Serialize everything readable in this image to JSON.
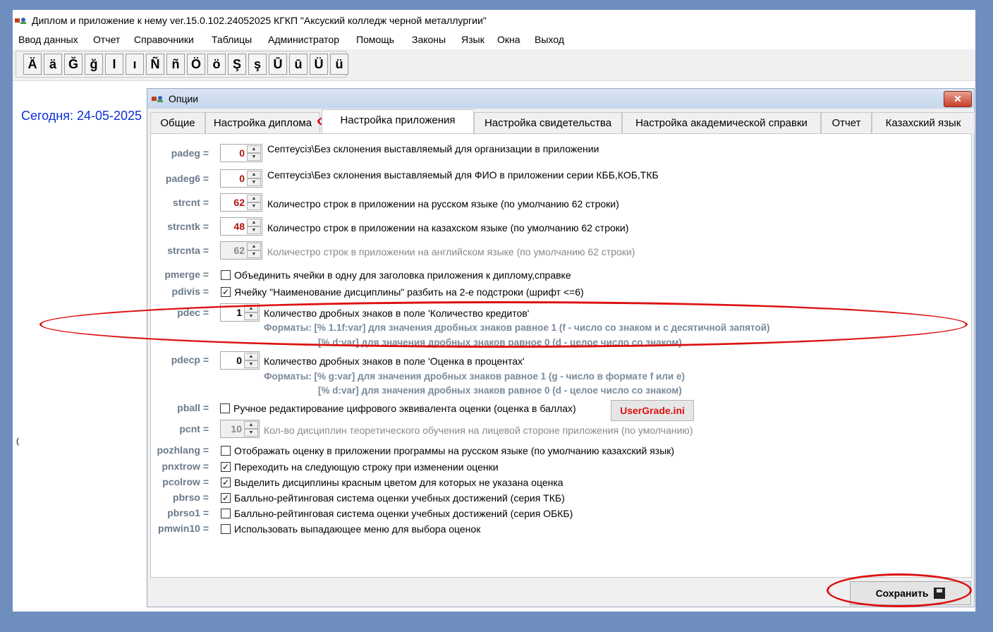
{
  "window": {
    "title": "Диплом и приложение к нему ver.15.0.102.24052025 КГКП \"Аксуский колледж черной металлургии\""
  },
  "menu": [
    "Ввод данных",
    "Отчет",
    "Справочники",
    "Таблицы",
    "Администратор",
    "Помощь",
    "Законы",
    "Язык",
    "Окна",
    "Выход"
  ],
  "keyboard": [
    "Ä",
    "ä",
    "Ğ",
    "ğ",
    "I",
    "ı",
    "Ñ",
    "ñ",
    "Ö",
    "ö",
    "Ş",
    "ş",
    "Ū",
    "ū",
    "Ü",
    "ü"
  ],
  "today_text": "Сегодня: 24-05-2025",
  "stray_char": "(",
  "under_text": "",
  "dialog": {
    "title": "Опции",
    "close_label": "✕",
    "tabs": [
      "Общие",
      "Настройка диплома",
      "Настройка приложения",
      "Настройка свидетельства",
      "Настройка академической справки",
      "Отчет",
      "Казахский язык"
    ],
    "active_tab": "Настройка приложения",
    "settings": {
      "padeg": {
        "label": "padeg =",
        "value": "0",
        "desc": "Септеусіз\\Без склонения выставляемый для организации в приложении"
      },
      "padeg6": {
        "label": "padeg6 =",
        "value": "0",
        "desc": "Септеусіз\\Без склонения выставляемый для ФИО в приложении серии КББ,КОБ,ТКБ"
      },
      "strcnt": {
        "label": "strcnt =",
        "value": "62",
        "desc": "Количестро строк в приложении на русском языке (по умолчанию 62 строки)"
      },
      "strcntk": {
        "label": "strcntk =",
        "value": "48",
        "desc": "Количестро строк в приложении на казахском языке (по умолчанию 62 строки)"
      },
      "strcnta": {
        "label": "strcnta =",
        "value": "62",
        "desc": "Количестро строк в приложении на английском языке (по умолчанию 62 строки)"
      },
      "pmerge": {
        "label": "pmerge =",
        "checked": false,
        "desc": "Объединить ячейки в одну для заголовка приложения к диплому,справке"
      },
      "pdivis": {
        "label": "pdivis =",
        "checked": true,
        "desc": "Ячейку \"Наименование дисциплины\" разбить на 2-е подстроки (шрифт <=6)"
      },
      "pdec": {
        "label": "pdec =",
        "value": "1",
        "desc": "Количество дробных знаков в поле 'Количество кредитов'",
        "fmt1": "Форматы: [% 1.1f:var] для значения дробных знаков равное 1 (f - число со знаком и с десятичной запятой)",
        "fmt2": "[% d:var] для значения дробных знаков равное 0 (d - целое число со знаком)"
      },
      "pdecp": {
        "label": "pdecp =",
        "value": "0",
        "desc": "Количество дробных знаков в поле 'Оценка в процентах'",
        "fmt1": "Форматы: [% g:var] для значения дробных знаков равное 1 (g - число в формате f или e)",
        "fmt2": "[% d:var] для значения дробных знаков равное 0 (d - целое число со знаком)"
      },
      "pball": {
        "label": "pball =",
        "checked": false,
        "desc": "Ручное редактирование цифрового эквивалента оценки (оценка в баллах)",
        "button": "UserGrade.ini"
      },
      "pcnt": {
        "label": "pcnt =",
        "value": "10",
        "desc": "Кол-во дисциплин теоретического обучения на лицевой стороне приложения (по умолчанию)"
      },
      "pozhlang": {
        "label": "pozhlang =",
        "checked": false,
        "desc": "Отображать оценку в приложении программы на русском языке (по умолчанию казахский язык)"
      },
      "pnxtrow": {
        "label": "pnxtrow =",
        "checked": true,
        "desc": "Переходить на следующую строку при изменении оценки"
      },
      "pcolrow": {
        "label": "pcolrow =",
        "checked": true,
        "desc": "Выделить дисциплины красным цветом для которых не указана оценка"
      },
      "pbrso": {
        "label": "pbrso =",
        "checked": true,
        "desc": "Балльно-рейтинговая система оценки учебных достижений (серия ТКБ)"
      },
      "pbrso1": {
        "label": "pbrso1 =",
        "checked": false,
        "desc": "Балльно-рейтинговая система оценки учебных достижений (серия ОБКБ)"
      },
      "pmwin10": {
        "label": "pmwin10 =",
        "checked": false,
        "desc": "Использовать выпадающее меню для выбора оценок"
      }
    },
    "save_label": "Сохранить"
  },
  "colors": {
    "highlight": "#dd1111",
    "today": "#0a30d8",
    "value": "#b01010",
    "button_text": "#e01010"
  }
}
